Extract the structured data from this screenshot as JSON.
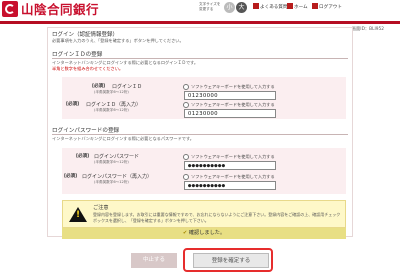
{
  "header": {
    "bank_name": "山陰合同銀行",
    "font_size_label": "文字サイズを変更する",
    "font_small": "小",
    "font_large": "大",
    "menu": [
      {
        "icon": "question-icon",
        "label": "よくある質問"
      },
      {
        "icon": "home-icon",
        "label": "ホーム"
      },
      {
        "icon": "logout-icon",
        "label": "ログアウト"
      }
    ],
    "screen_id": "画面ID：BLI952"
  },
  "page": {
    "title": "ログイン（認証情報登録）",
    "instructions": "必要事項を入力のうえ、「登録を確定する」ボタンを押してください。"
  },
  "login_id_section": {
    "heading": "ログインＩＤの登録",
    "desc1": "インターネットバンキングにログインする際に必要となるログインＩＤです。",
    "desc2": "半角と数字を組み合わせてください。",
    "rows": [
      {
        "required": "[必須]",
        "label": "ログインＩＤ",
        "note": "(半角英数字6～12桁)",
        "software_kb": "ソフトウェアキーボードを使用して入力する",
        "value": "O123OOOO"
      },
      {
        "required": "[必須]",
        "label": "ログインＩＤ（再入力）",
        "note": "(半角英数字6～12桁)",
        "software_kb": "ソフトウェアキーボードを使用して入力する",
        "value": "O123OOOO"
      }
    ]
  },
  "password_section": {
    "heading": "ログインパスワードの登録",
    "desc1": "インターネットバンキングにログインする際に必要となるパスワードです。",
    "rows": [
      {
        "required": "[必須]",
        "label": "ログインパスワード",
        "note": "(半角英数字6～12桁)",
        "software_kb": "ソフトウェアキーボードを使用して入力する",
        "value": "●●●●●●●●●●"
      },
      {
        "required": "[必須]",
        "label": "ログインパスワード（再入力）",
        "note": "(半角英数字6～12桁)",
        "software_kb": "ソフトウェアキーボードを使用して入力する",
        "value": "●●●●●●●●●●"
      }
    ]
  },
  "notice": {
    "title": "ご注意",
    "text": "登録内容を登録します。お取引には重要な情報ですので、お忘れにならないようにご注意下さい。登録内容をご確認の上、確認用チェックボックスを選択し、「登録を確定する」ボタンを押して下さい。",
    "confirm_mark": "✔",
    "confirm_label": "確認しました。"
  },
  "buttons": {
    "cancel": "中止する",
    "confirm": "登録を確定する"
  }
}
